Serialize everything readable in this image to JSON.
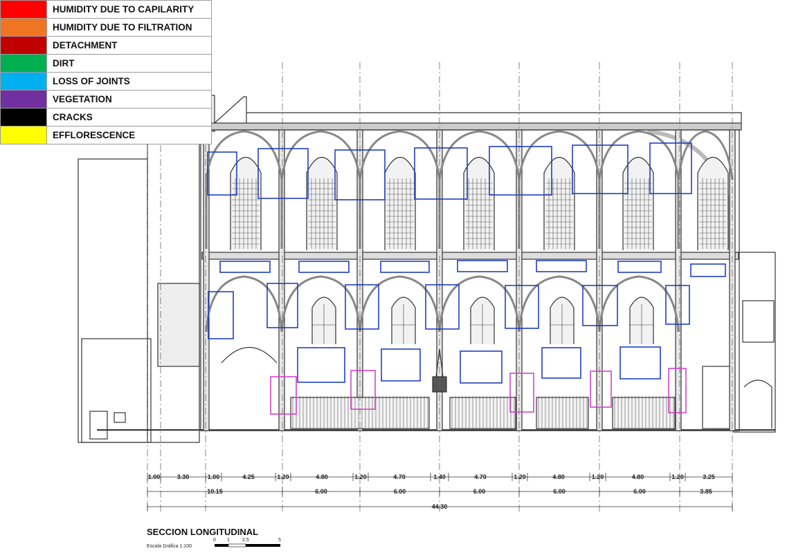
{
  "legend": [
    {
      "label": "HUMIDITY DUE TO CAPILARITY",
      "color": "#ff0000"
    },
    {
      "label": " HUMIDITY DUE TO FILTRATION",
      "color": "#f07522"
    },
    {
      "label": "DETACHMENT",
      "color": "#c00000"
    },
    {
      "label": "DIRT",
      "color": "#00b050"
    },
    {
      "label": "LOSS OF JOINTS",
      "color": "#00b0f0"
    },
    {
      "label": "VEGETATION",
      "color": "#7030a0"
    },
    {
      "label": "CRACKS",
      "color": "#000000"
    },
    {
      "label": "EFFLORESCENCE",
      "color": "#ffff00"
    }
  ],
  "dimensions": {
    "row1": [
      "1.00",
      "3.30",
      "1.00",
      "4.25",
      "1.20",
      "4.80",
      "1.20",
      "4.70",
      "1.40",
      "4.70",
      "1.20",
      "4.80",
      "1.20",
      "4.80",
      "1.20",
      "3.25"
    ],
    "row2": [
      "10.15",
      "6.00",
      "6.00",
      "6.00",
      "6.00",
      "6.00",
      "3.85"
    ],
    "total": "44.30"
  },
  "title": {
    "section": "SECCION LONGITUDINAL",
    "scale": "Escala Gráfica 1:100",
    "scale_ticks": [
      "0",
      "1",
      "2.5",
      "5"
    ]
  },
  "marker_colors": {
    "blue": "#1f3fbf",
    "magenta": "#d044c8"
  }
}
